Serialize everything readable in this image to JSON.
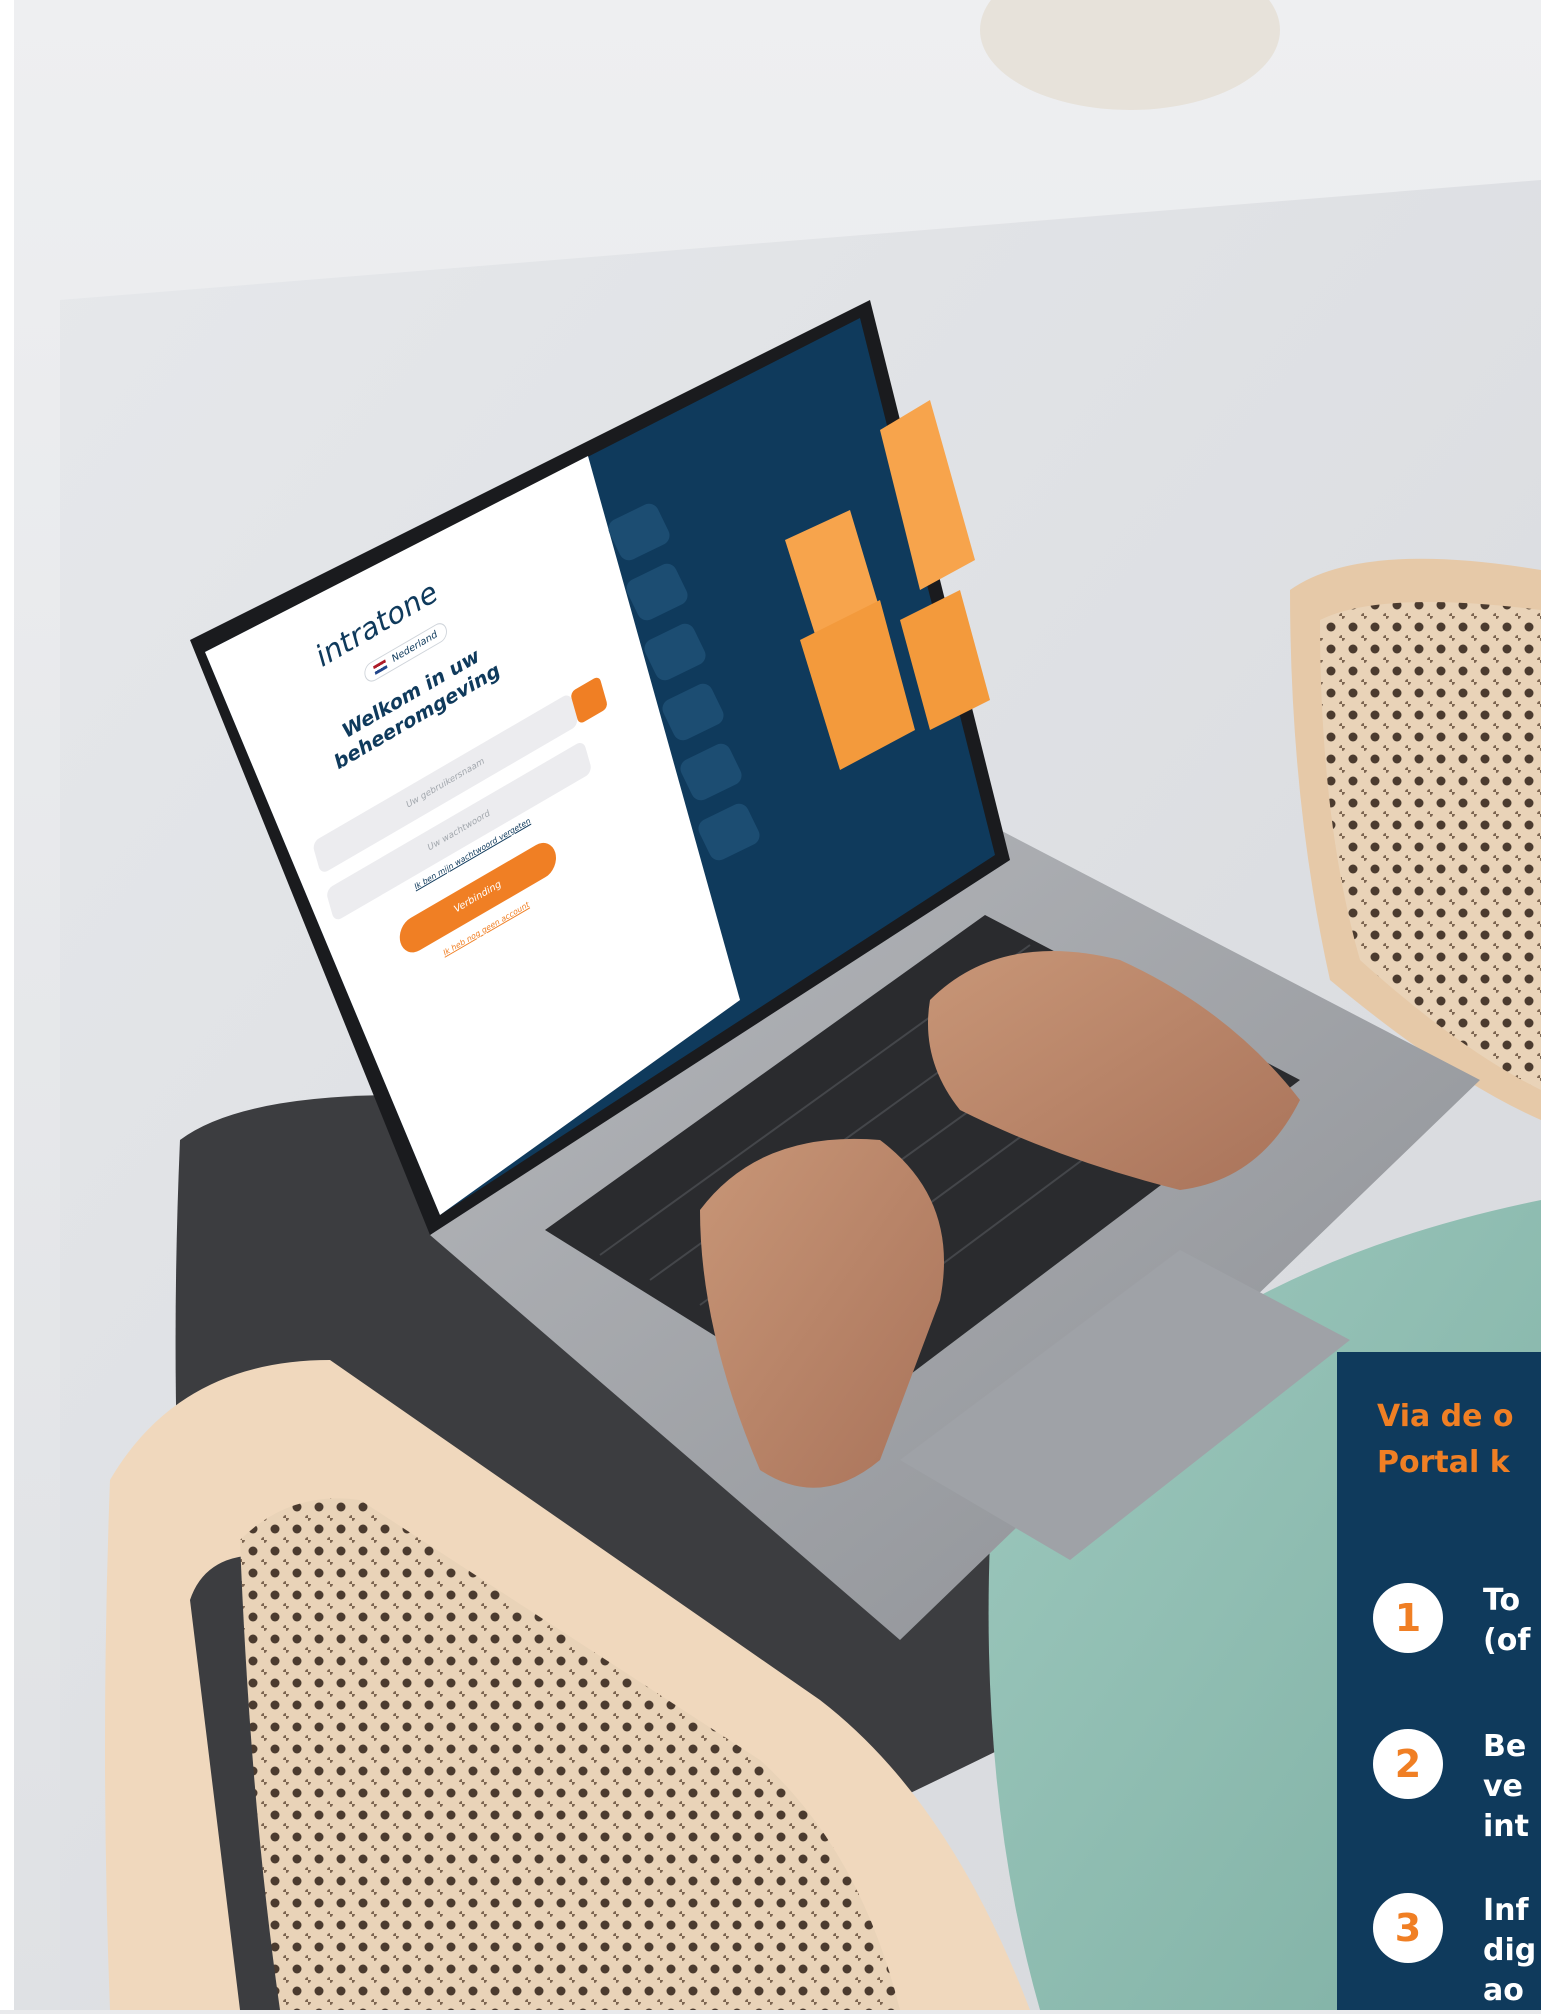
{
  "screen": {
    "logo_text": "intratone",
    "language_label": "Nederland",
    "welcome_line1": "Welkom in uw",
    "welcome_line2": "beheeromgeving",
    "username_placeholder": "Uw gebruikersnaam",
    "password_placeholder": "Uw wachtwoord",
    "forgot_password_link": "Ik ben mijn wachtwoord vergeten",
    "login_button": "Verbinding",
    "no_access_link": "Ik heb nog geen account",
    "side_features": [
      "icon-1",
      "icon-2",
      "icon-3",
      "icon-4",
      "icon-5",
      "icon-6"
    ]
  },
  "info": {
    "title_line1": "Via de o",
    "title_line2": "Portal k",
    "steps": [
      {
        "num": "1",
        "line1": "To",
        "line2": "(of",
        "line3": ""
      },
      {
        "num": "2",
        "line1": "Be",
        "line2": "ve",
        "line3": "int"
      },
      {
        "num": "3",
        "line1": "Inf",
        "line2": "dig",
        "line3": "ao"
      }
    ]
  },
  "colors": {
    "navy": "#0f3a5c",
    "orange": "#f07f24",
    "white": "#ffffff"
  }
}
